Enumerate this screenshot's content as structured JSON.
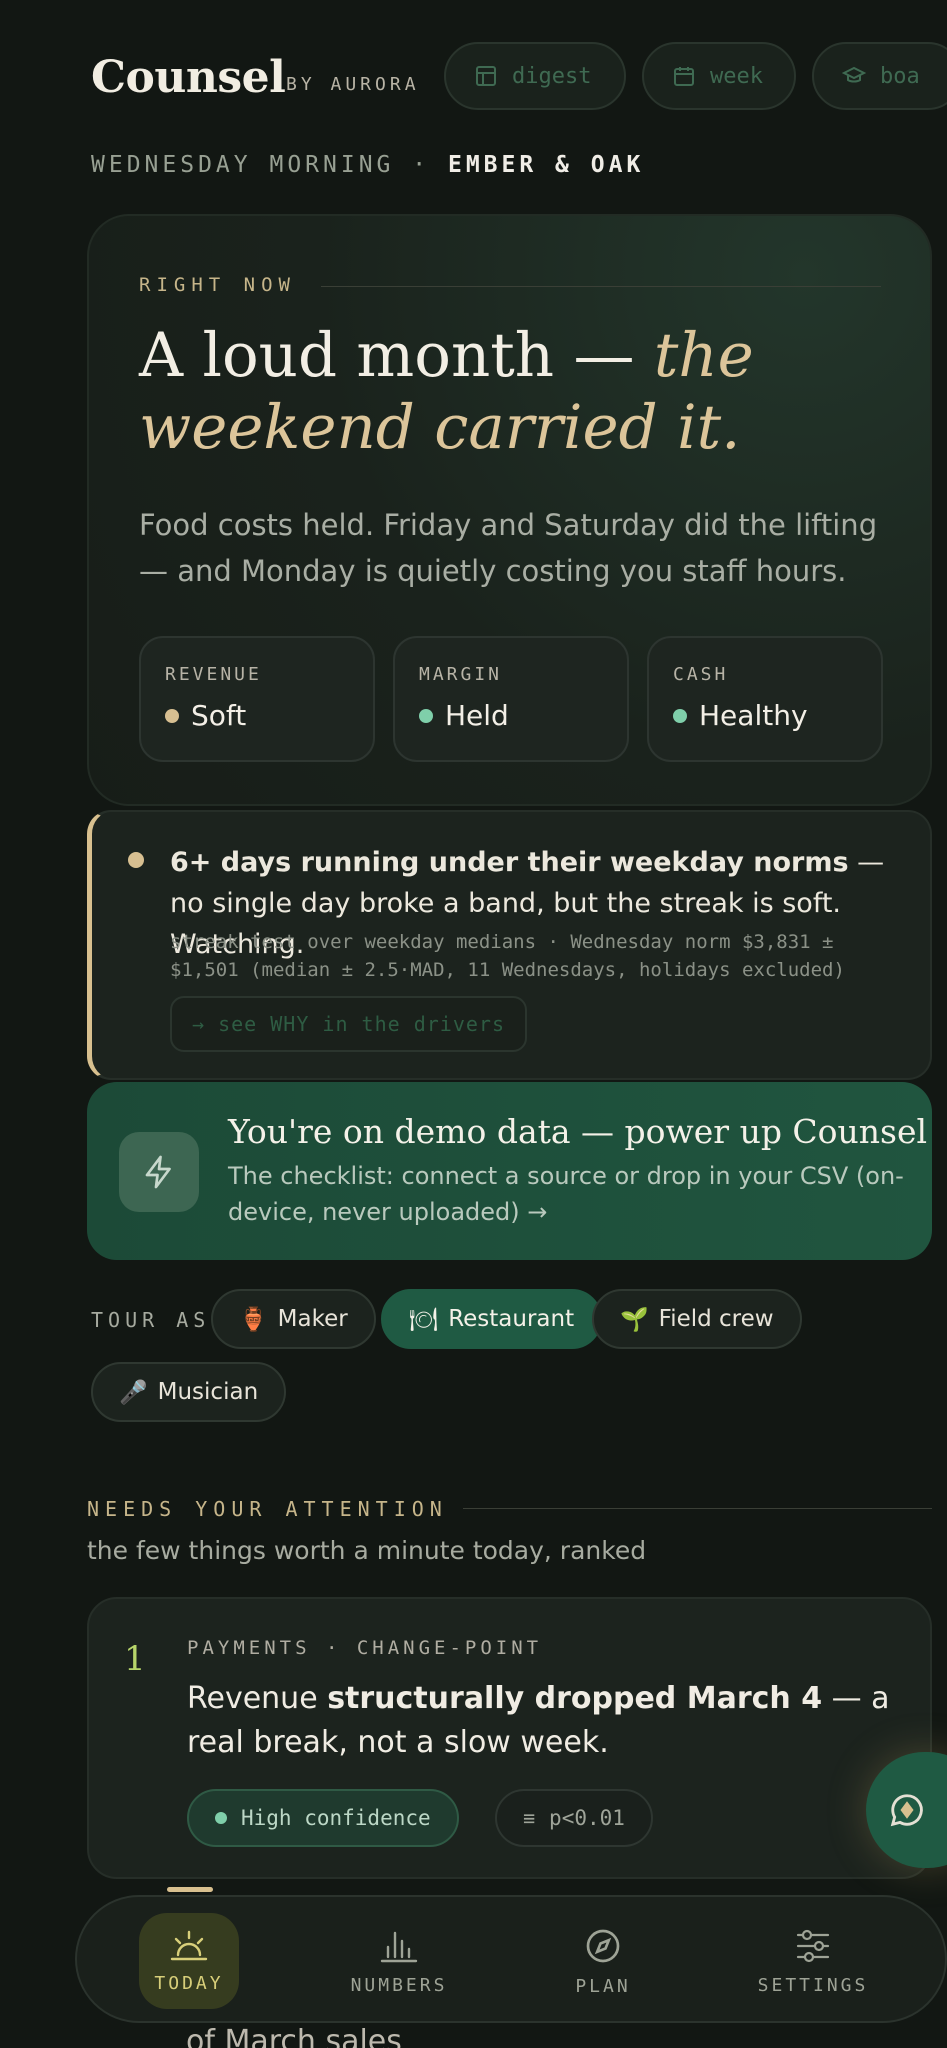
{
  "header": {
    "brand": "Counsel",
    "brand_sub": "BY AURORA",
    "nav_pills": [
      {
        "label": "digest",
        "icon": "layout-icon"
      },
      {
        "label": "week",
        "icon": "calendar-icon"
      },
      {
        "label": "boa",
        "icon": "graduation-cap-icon"
      }
    ]
  },
  "dateline": {
    "prefix": "WEDNESDAY MORNING ·",
    "place": "EMBER & OAK"
  },
  "hero": {
    "eyebrow": "RIGHT NOW",
    "headline_plain": "A loud month —",
    "headline_em": "the weekend carried it.",
    "sub": "Food costs held. Friday and Saturday did the lifting — and Monday is quietly costing you staff hours.",
    "metrics": [
      {
        "label": "REVENUE",
        "value": "Soft",
        "color": "#d7bf91"
      },
      {
        "label": "MARGIN",
        "value": "Held",
        "color": "#7fcfaa"
      },
      {
        "label": "CASH",
        "value": "Healthy",
        "color": "#7fcfaa"
      }
    ]
  },
  "alert": {
    "bold": "6+ days running under their weekday norms",
    "rest": " — no single day broke a band, but the streak is soft. Watching.",
    "meta": "streak test over weekday medians · Wednesday norm $3,831 ± $1,501 (median ± 2.5·MAD, 11 Wednesdays, holidays excluded)",
    "button": "→ see WHY in the drivers"
  },
  "demo": {
    "title": "You're on demo data — power up Counsel",
    "sub": "The checklist: connect a source or drop in your CSV (on-device, never uploaded) →"
  },
  "tour": {
    "label": "TOUR AS",
    "chips": [
      {
        "emoji": "🏺",
        "label": "Maker"
      },
      {
        "emoji": "🍽",
        "label": "Restaurant"
      },
      {
        "emoji": "🌱",
        "label": "Field crew"
      },
      {
        "emoji": "🎤",
        "label": "Musician"
      }
    ]
  },
  "attention": {
    "eyebrow": "NEEDS YOUR ATTENTION",
    "sub": "the few things worth a minute today, ranked",
    "item": {
      "num": "1",
      "tag": "PAYMENTS · CHANGE-POINT",
      "text_pre": "Revenue ",
      "text_bold": "structurally dropped March 4",
      "text_post": " — a real break, not a slow week.",
      "confidence": "High confidence",
      "p_value": "p<0.01"
    },
    "behind_text": "of March sales"
  },
  "bottom_nav": [
    {
      "label": "TODAY",
      "icon": "sunrise-icon",
      "active": true
    },
    {
      "label": "NUMBERS",
      "icon": "bar-chart-icon",
      "active": false
    },
    {
      "label": "PLAN",
      "icon": "compass-icon",
      "active": false
    },
    {
      "label": "SETTINGS",
      "icon": "sliders-icon",
      "active": false
    }
  ]
}
